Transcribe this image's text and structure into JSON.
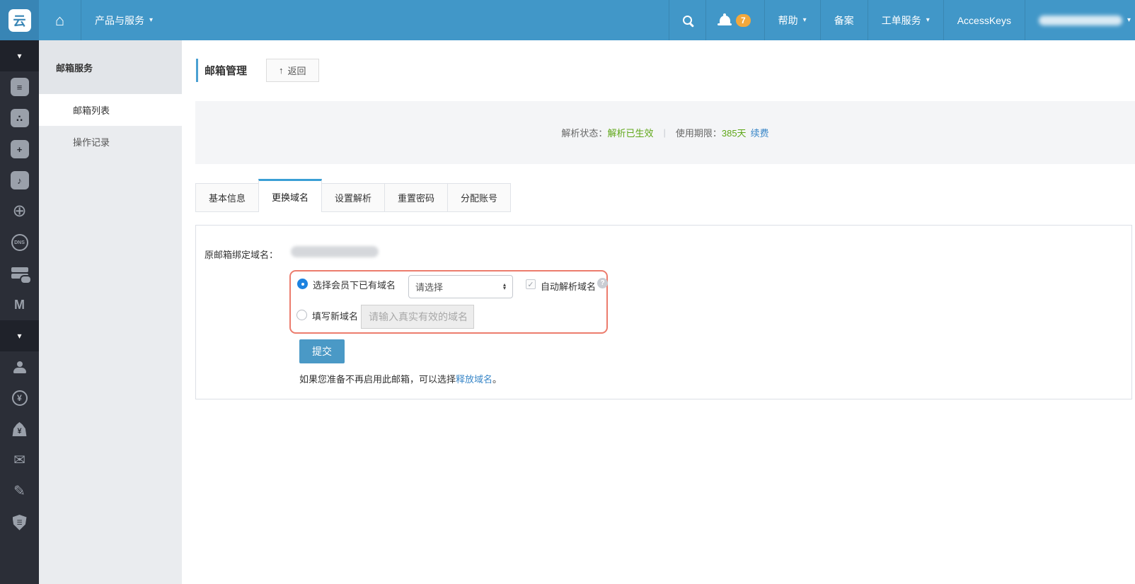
{
  "navbar": {
    "logo_text": "云",
    "products_menu": "产品与服务",
    "notification_count": "7",
    "help_label": "帮助",
    "beian_label": "备案",
    "ticket_label": "工单服务",
    "accesskeys_label": "AccessKeys",
    "icons": [
      "home-icon",
      "search-icon",
      "bell-icon",
      "account-chevron-icon"
    ]
  },
  "iconbar": {
    "icons_group1": [
      "chevron-down-icon",
      "console-icon",
      "share-nodes-icon",
      "scaling-icon",
      "media-icon",
      "globe-icon",
      "dns-icon",
      "storage-icon",
      "m-product-icon"
    ],
    "icons_group2": [
      "chevron-down-icon",
      "user-icon",
      "yuan-icon",
      "moneybag-icon",
      "mail-icon",
      "pencil-icon",
      "shield-icon"
    ],
    "dns_text": "DNS",
    "m_text": "M"
  },
  "subsidebar": {
    "header": "邮箱服务",
    "items": [
      {
        "label": "邮箱列表",
        "active": true
      },
      {
        "label": "操作记录",
        "active": false
      }
    ]
  },
  "page": {
    "title": "邮箱管理",
    "back_label": "返回",
    "status": {
      "resolve_label": "解析状态：",
      "resolve_value": "解析已生效",
      "divider": "|",
      "period_label": "使用期限：",
      "period_value": "385天",
      "renew_link": "续费"
    },
    "tabs": [
      "基本信息",
      "更换域名",
      "设置解析",
      "重置密码",
      "分配账号"
    ],
    "active_tab": "更换域名",
    "form": {
      "domain_label": "原邮箱绑定域名：",
      "option_existing": "选择会员下已有域名",
      "select_value": "请选择",
      "auto_resolve_label": "自动解析域名",
      "option_new": "填写新域名",
      "input_placeholder": "请输入真实有效的域名",
      "submit_label": "提交",
      "footer_text_before": "如果您准备不再启用此邮箱，可以选择",
      "footer_link": "释放域名",
      "footer_text_after": "。"
    }
  },
  "colors": {
    "navbar_blue": "#4197c8",
    "logo_block_blue": "#3885b5",
    "tab_accent_blue": "#3a9fd5",
    "status_green": "#5fa718",
    "link_blue": "#3a87c8",
    "highlight_red": "#ec7c6d",
    "submit_blue": "#4a99c6",
    "badge_orange": "#f3a83c",
    "sidebar_dark": "#2b2e37"
  }
}
